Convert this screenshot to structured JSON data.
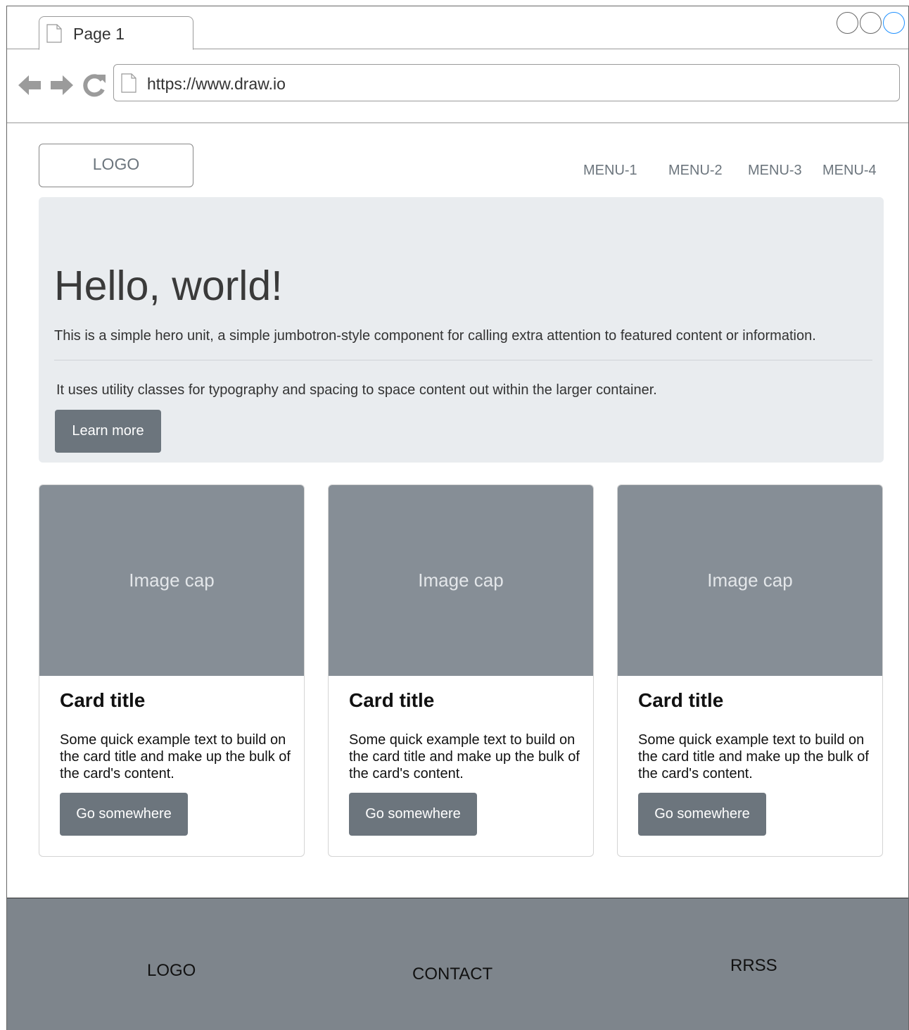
{
  "browser": {
    "tab_title": "Page 1",
    "url": "https://www.draw.io"
  },
  "header": {
    "logo": "LOGO",
    "menu": [
      "MENU-1",
      "MENU-2",
      "MENU-3",
      "MENU-4"
    ]
  },
  "hero": {
    "heading": "Hello, world!",
    "lead": "This is a simple hero unit, a simple jumbotron-style component for calling extra attention to featured content or information.",
    "body": "It uses utility classes for typography and spacing to space content out within the larger container.",
    "button": "Learn more"
  },
  "cards": [
    {
      "image_label": "Image cap",
      "title": "Card title",
      "text": "Some quick example text to build on the card title and make up the bulk of the card's content.",
      "button": "Go somewhere"
    },
    {
      "image_label": "Image cap",
      "title": "Card title",
      "text": "Some quick example text to build on the card title and make up the bulk of the card's content.",
      "button": "Go somewhere"
    },
    {
      "image_label": "Image cap",
      "title": "Card title",
      "text": "Some quick example text to build on the card title and make up the bulk of the card's content.",
      "button": "Go somewhere"
    }
  ],
  "footer": {
    "logo": "LOGO",
    "contact": "CONTACT",
    "social": "RRSS"
  },
  "colors": {
    "hero_bg": "#e9ecef",
    "button_bg": "#6c757d",
    "image_cap_bg": "#868e96",
    "footer_bg": "#7e858c"
  }
}
